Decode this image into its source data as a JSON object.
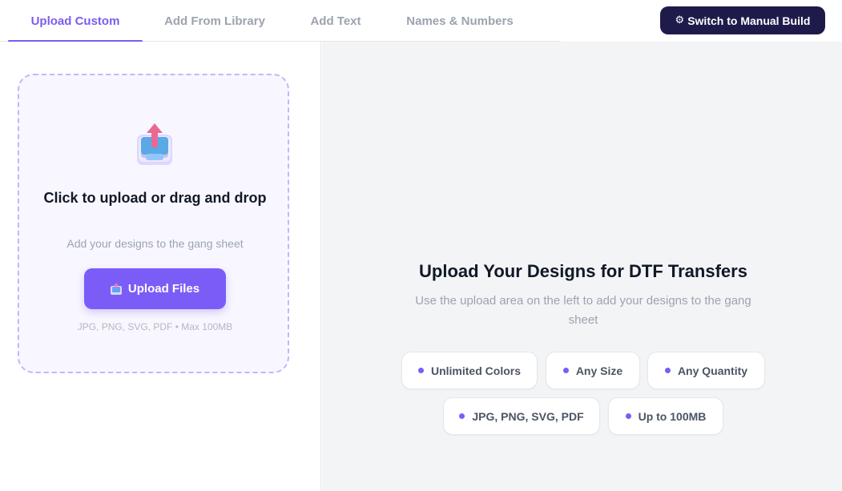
{
  "tabs": [
    {
      "label": "Upload Custom",
      "active": true
    },
    {
      "label": "Add From Library",
      "active": false
    },
    {
      "label": "Add Text",
      "active": false
    },
    {
      "label": "Names & Numbers",
      "active": false
    }
  ],
  "header": {
    "manual_build_icon": "gear-icon",
    "manual_build_label": "Switch to Manual Build"
  },
  "upload": {
    "illustration": "upload-tray-icon",
    "title": "Click to upload or drag and drop",
    "subtitle": "Add your designs to the gang sheet",
    "button_icon": "inbox-upload-icon",
    "button_label": "Upload Files",
    "formats": "JPG, PNG, SVG, PDF • Max 100MB"
  },
  "info": {
    "title": "Upload Your Designs for DTF Transfers",
    "subtitle": "Use the upload area on the left to add your designs to the gang sheet",
    "features": [
      "Unlimited Colors",
      "Any Size",
      "Any Quantity",
      "JPG, PNG, SVG, PDF",
      "Up to 100MB"
    ]
  },
  "colors": {
    "accent": "#7c5cf6",
    "dark_button": "#1e1b4b",
    "panel_bg": "#f3f4f6",
    "dropzone_border": "#c4b5fd"
  }
}
